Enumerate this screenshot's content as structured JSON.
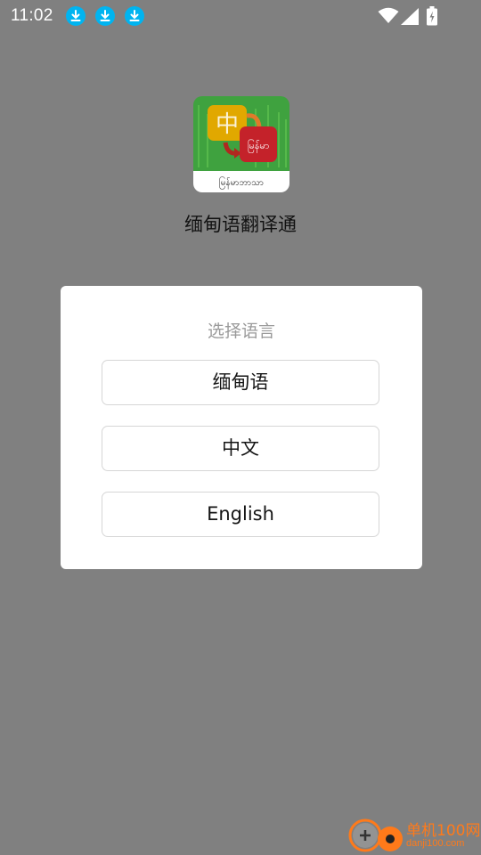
{
  "status_bar": {
    "time": "11:02",
    "notifications": [
      "download-icon",
      "download-icon",
      "download-icon"
    ],
    "system_icons": [
      "wifi-icon",
      "cell-signal-icon",
      "battery-charging-icon"
    ]
  },
  "app": {
    "logo_label": "မြန်မာဘာသာ",
    "logo_chars": {
      "chinese": "中",
      "myanmar": "မြန်မာ"
    },
    "title": "缅甸语翻译通"
  },
  "dialog": {
    "title": "选择语言",
    "options": [
      {
        "label": "缅甸语"
      },
      {
        "label": "中文"
      },
      {
        "label": "English"
      }
    ]
  },
  "watermark": {
    "text": "单机100网",
    "sub": "danji100.com"
  },
  "colors": {
    "overlay": "#808080",
    "dialog_bg": "#ffffff",
    "dialog_title": "#9a9a9a",
    "download_badge": "#00b4f0",
    "watermark": "#ff7a1a"
  }
}
